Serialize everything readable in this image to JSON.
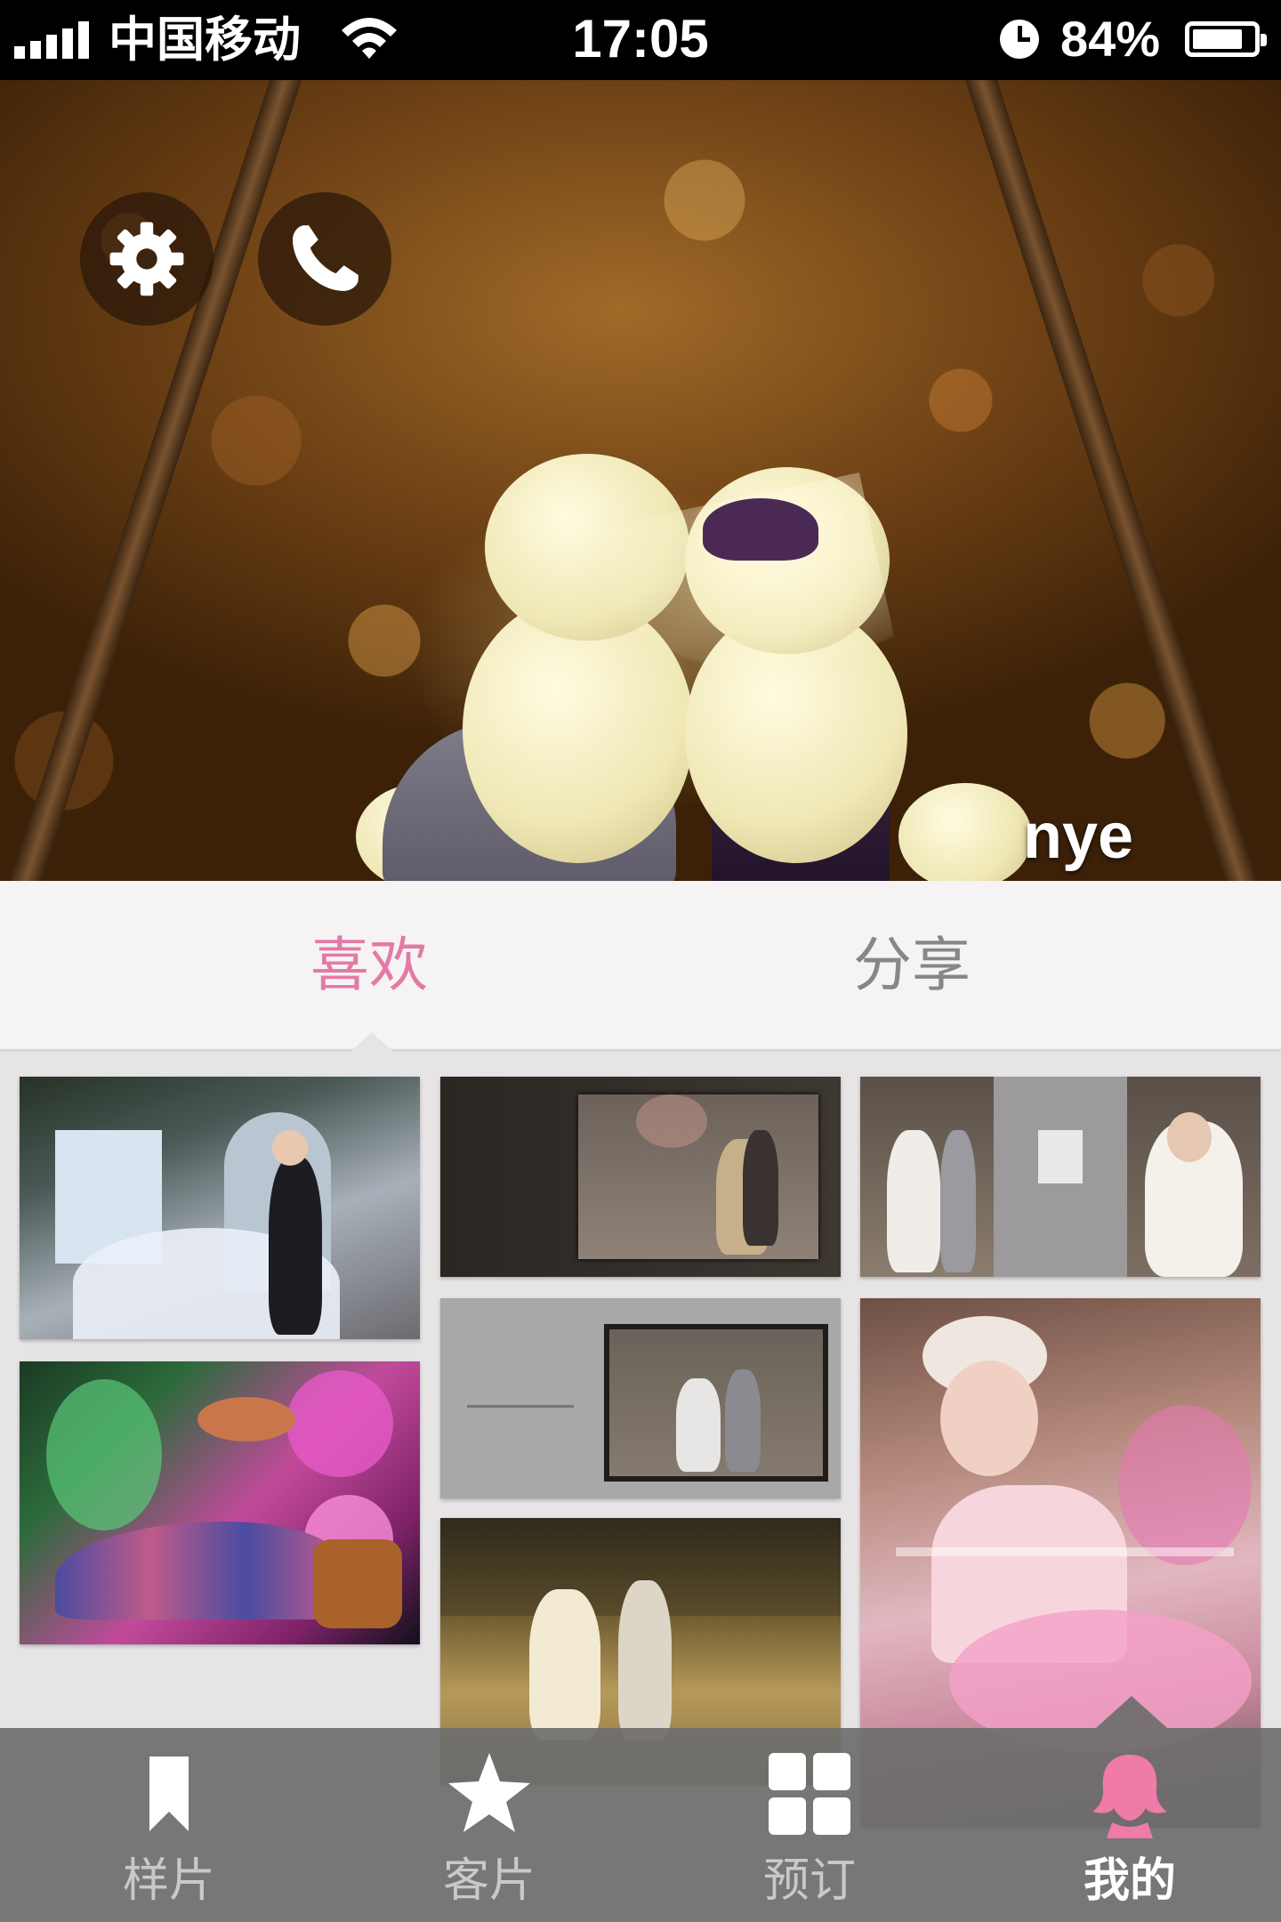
{
  "status_bar": {
    "carrier": "中国移动",
    "time": "17:05",
    "battery_percent_label": "84%",
    "battery_level": 0.84,
    "signal_bars": 5,
    "wifi_icon": "wifi-icon",
    "alarm_icon": "clock-icon"
  },
  "profile": {
    "username": "nye",
    "settings_icon": "gear-icon",
    "call_icon": "phone-icon"
  },
  "tabs": {
    "items": [
      {
        "label": "喜欢",
        "active": true
      },
      {
        "label": "分享",
        "active": false
      }
    ],
    "active_color": "#e37aa5",
    "inactive_color": "#888686"
  },
  "photos": {
    "count": 7
  },
  "bottom_nav": {
    "items": [
      {
        "label": "样片",
        "icon": "bookmark-icon",
        "active": false
      },
      {
        "label": "客片",
        "icon": "star-icon",
        "active": false
      },
      {
        "label": "预订",
        "icon": "grid-icon",
        "active": false
      },
      {
        "label": "我的",
        "icon": "person-icon",
        "active": true
      }
    ],
    "accent_color": "#f07aa8"
  }
}
